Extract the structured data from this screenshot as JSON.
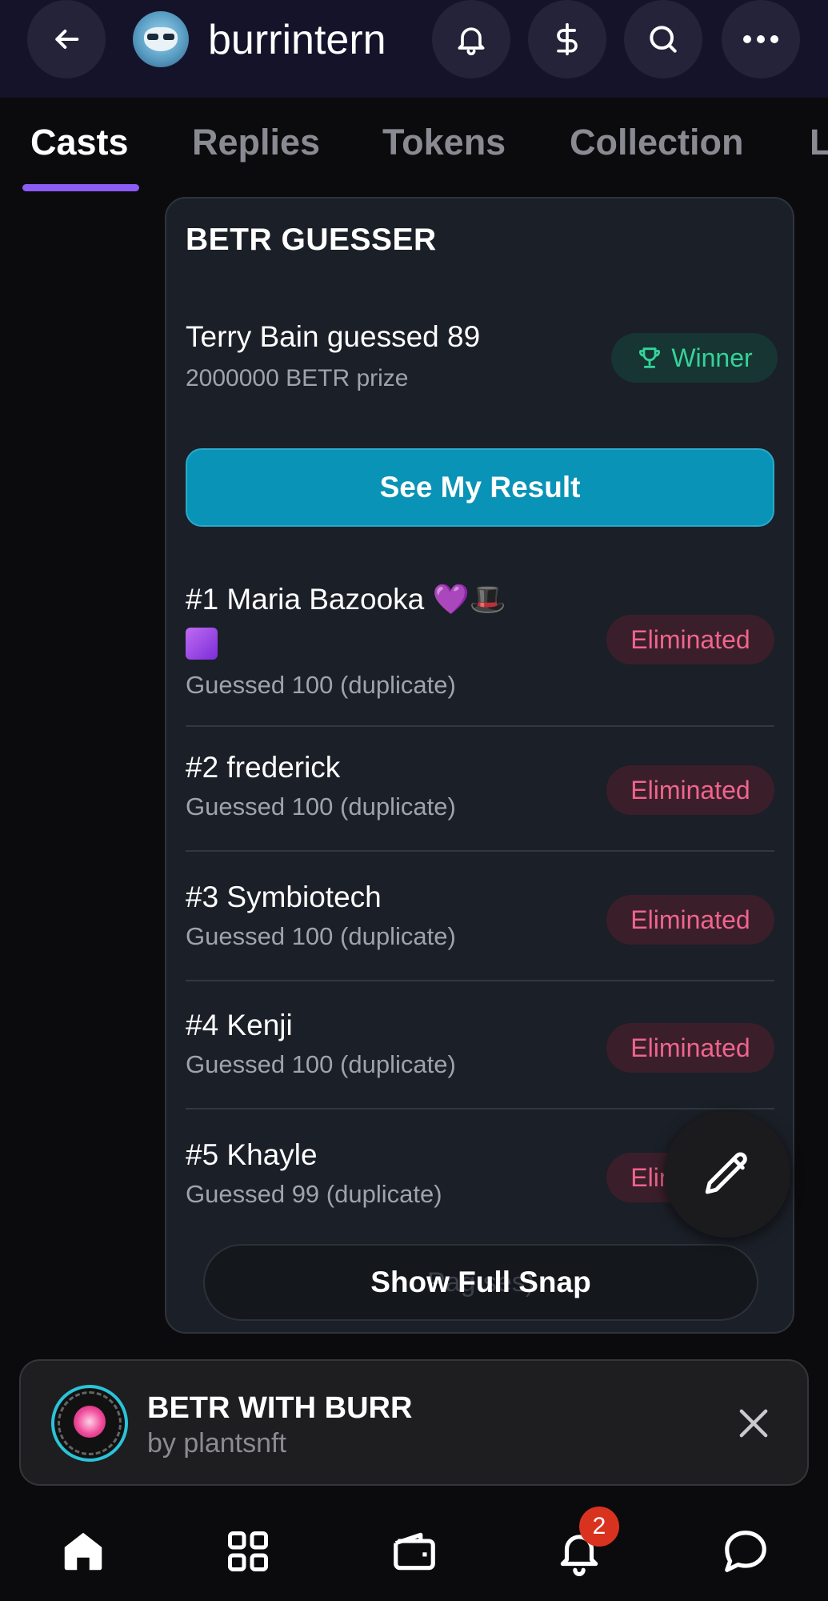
{
  "header": {
    "username": "burrintern",
    "icons": [
      "back-arrow-icon",
      "bell-icon",
      "dollar-icon",
      "search-icon",
      "more-icon"
    ]
  },
  "tabs": [
    {
      "label": "Casts",
      "active": true
    },
    {
      "label": "Replies",
      "active": false
    },
    {
      "label": "Tokens",
      "active": false
    },
    {
      "label": "Collection",
      "active": false
    },
    {
      "label": "L",
      "active": false
    }
  ],
  "card": {
    "title": "BETR GUESSER",
    "winner": {
      "line": "Terry Bain guessed 89",
      "prize": "2000000 BETR prize",
      "badge": "Winner"
    },
    "result_button": "See My Result",
    "rows": [
      {
        "name": "#1 Maria Bazooka",
        "guess": "Guessed 100 (duplicate)",
        "status": "Eliminated"
      },
      {
        "name": "#2 frederick",
        "guess": "Guessed 100 (duplicate)",
        "status": "Eliminated"
      },
      {
        "name": "#3 Symbiotech",
        "guess": "Guessed 100 (duplicate)",
        "status": "Eliminated"
      },
      {
        "name": "#4 Kenji",
        "guess": "Guessed 100 (duplicate)",
        "status": "Eliminated"
      },
      {
        "name": "#5 Khayle",
        "guess": "Guessed 99 (duplicate)",
        "status": "Eliminated"
      }
    ],
    "snap_button": "Show Full Snap",
    "snap_ghost": "Pag           ses)"
  },
  "miniapp": {
    "title": "BETR WITH BURR",
    "byline": "by plantsnft"
  },
  "nav": {
    "notification_count": "2",
    "items": [
      "home-icon",
      "apps-grid-icon",
      "wallet-icon",
      "notifications-icon",
      "chat-icon"
    ]
  },
  "colors": {
    "accent": "#8b5cf6",
    "primary_button": "#0993b6",
    "winner_green": "#34d399",
    "eliminated_pink": "#f0648e",
    "badge_red": "#d9331f"
  }
}
